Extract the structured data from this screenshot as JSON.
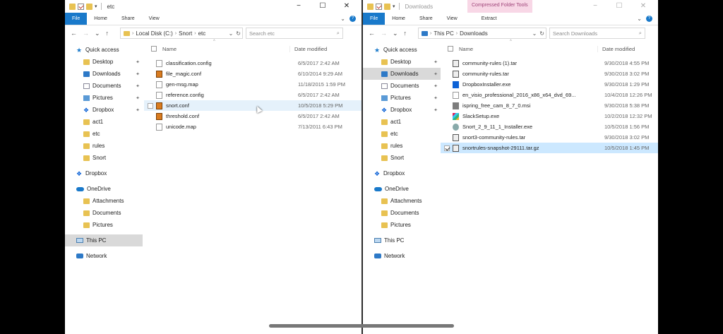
{
  "left": {
    "title": "etc",
    "tabs": [
      "File",
      "Home",
      "Share",
      "View"
    ],
    "address": [
      "Local Disk (C:)",
      "Snort",
      "etc"
    ],
    "search_placeholder": "Search etc",
    "nav": [
      {
        "label": "Quick access",
        "icon": "star-icon",
        "level": 1
      },
      {
        "label": "Desktop",
        "icon": "folder-icon",
        "level": 2,
        "pinned": true
      },
      {
        "label": "Downloads",
        "icon": "download-folder-icon",
        "level": 2,
        "pinned": true
      },
      {
        "label": "Documents",
        "icon": "documents-icon",
        "level": 2,
        "pinned": true
      },
      {
        "label": "Pictures",
        "icon": "pictures-icon",
        "level": 2,
        "pinned": true
      },
      {
        "label": "Dropbox",
        "icon": "dropbox-icon",
        "level": 2,
        "pinned": true
      },
      {
        "label": "act1",
        "icon": "folder-icon",
        "level": 2
      },
      {
        "label": "etc",
        "icon": "folder-icon",
        "level": 2
      },
      {
        "label": "rules",
        "icon": "folder-icon",
        "level": 2
      },
      {
        "label": "Snort",
        "icon": "folder-icon",
        "level": 2
      },
      {
        "label": "Dropbox",
        "icon": "dropbox-icon",
        "level": 1,
        "gap": true
      },
      {
        "label": "OneDrive",
        "icon": "onedrive-icon",
        "level": 1,
        "gap": true
      },
      {
        "label": "Attachments",
        "icon": "folder-icon",
        "level": 2
      },
      {
        "label": "Documents",
        "icon": "folder-icon",
        "level": 2
      },
      {
        "label": "Pictures",
        "icon": "folder-icon",
        "level": 2
      },
      {
        "label": "This PC",
        "icon": "this-pc-icon",
        "level": 1,
        "gap": true,
        "selected": true
      },
      {
        "label": "Network",
        "icon": "network-icon",
        "level": 1,
        "gap": true
      }
    ],
    "columns": {
      "name": "Name",
      "date": "Date modified"
    },
    "files": [
      {
        "name": "classification.config",
        "date": "6/5/2017 2:42 AM",
        "icon": "document-icon"
      },
      {
        "name": "file_magic.conf",
        "date": "6/10/2014 9:29 AM",
        "icon": "snort-file-icon"
      },
      {
        "name": "gen-msg.map",
        "date": "11/18/2015 1:59 PM",
        "icon": "document-icon"
      },
      {
        "name": "reference.config",
        "date": "6/5/2017 2:42 AM",
        "icon": "document-icon"
      },
      {
        "name": "snort.conf",
        "date": "10/5/2018 5:29 PM",
        "icon": "snort-file-icon",
        "hover": true
      },
      {
        "name": "threshold.conf",
        "date": "6/5/2017 2:42 AM",
        "icon": "snort-file-icon"
      },
      {
        "name": "unicode.map",
        "date": "7/13/2011 6:43 PM",
        "icon": "document-icon"
      }
    ]
  },
  "right": {
    "title": "Downloads",
    "context_tab": "Compressed Folder Tools",
    "tabs": [
      "File",
      "Home",
      "Share",
      "View"
    ],
    "extract_tab": "Extract",
    "address": [
      "This PC",
      "Downloads"
    ],
    "search_placeholder": "Search Downloads",
    "nav": [
      {
        "label": "Quick access",
        "icon": "star-icon",
        "level": 1
      },
      {
        "label": "Desktop",
        "icon": "folder-icon",
        "level": 2,
        "pinned": true
      },
      {
        "label": "Downloads",
        "icon": "download-folder-icon",
        "level": 2,
        "pinned": true,
        "selected": true
      },
      {
        "label": "Documents",
        "icon": "documents-icon",
        "level": 2,
        "pinned": true
      },
      {
        "label": "Pictures",
        "icon": "pictures-icon",
        "level": 2,
        "pinned": true
      },
      {
        "label": "Dropbox",
        "icon": "dropbox-icon",
        "level": 2,
        "pinned": true
      },
      {
        "label": "act1",
        "icon": "folder-icon",
        "level": 2
      },
      {
        "label": "etc",
        "icon": "folder-icon",
        "level": 2
      },
      {
        "label": "rules",
        "icon": "folder-icon",
        "level": 2
      },
      {
        "label": "Snort",
        "icon": "folder-icon",
        "level": 2
      },
      {
        "label": "Dropbox",
        "icon": "dropbox-icon",
        "level": 1,
        "gap": true
      },
      {
        "label": "OneDrive",
        "icon": "onedrive-icon",
        "level": 1,
        "gap": true
      },
      {
        "label": "Attachments",
        "icon": "folder-icon",
        "level": 2
      },
      {
        "label": "Documents",
        "icon": "folder-icon",
        "level": 2
      },
      {
        "label": "Pictures",
        "icon": "folder-icon",
        "level": 2
      },
      {
        "label": "This PC",
        "icon": "this-pc-icon",
        "level": 1,
        "gap": true
      },
      {
        "label": "Network",
        "icon": "network-icon",
        "level": 1,
        "gap": true
      }
    ],
    "columns": {
      "name": "Name",
      "date": "Date modified"
    },
    "files": [
      {
        "name": "community-rules (1).tar",
        "date": "9/30/2018 4:55 PM",
        "icon": "archive-icon"
      },
      {
        "name": "community-rules.tar",
        "date": "9/30/2018 3:02 PM",
        "icon": "archive-icon"
      },
      {
        "name": "DropboxInstaller.exe",
        "date": "9/30/2018 1:29 PM",
        "icon": "dropbox-installer-icon"
      },
      {
        "name": "en_visio_professional_2016_x86_x64_dvd_69...",
        "date": "10/4/2018 12:26 PM",
        "icon": "document-icon"
      },
      {
        "name": "ispring_free_cam_8_7_0.msi",
        "date": "9/30/2018 5:38 PM",
        "icon": "installer-icon"
      },
      {
        "name": "SlackSetup.exe",
        "date": "10/2/2018 12:32 PM",
        "icon": "slack-icon"
      },
      {
        "name": "Snort_2_9_11_1_Installer.exe",
        "date": "10/5/2018 1:56 PM",
        "icon": "setup-icon"
      },
      {
        "name": "snort3-community-rules.tar",
        "date": "9/30/2018 3:02 PM",
        "icon": "archive-icon"
      },
      {
        "name": "snortrules-snapshot-29111.tar.gz",
        "date": "10/5/2018 1:45 PM",
        "icon": "archive-icon",
        "selected": true
      }
    ]
  }
}
